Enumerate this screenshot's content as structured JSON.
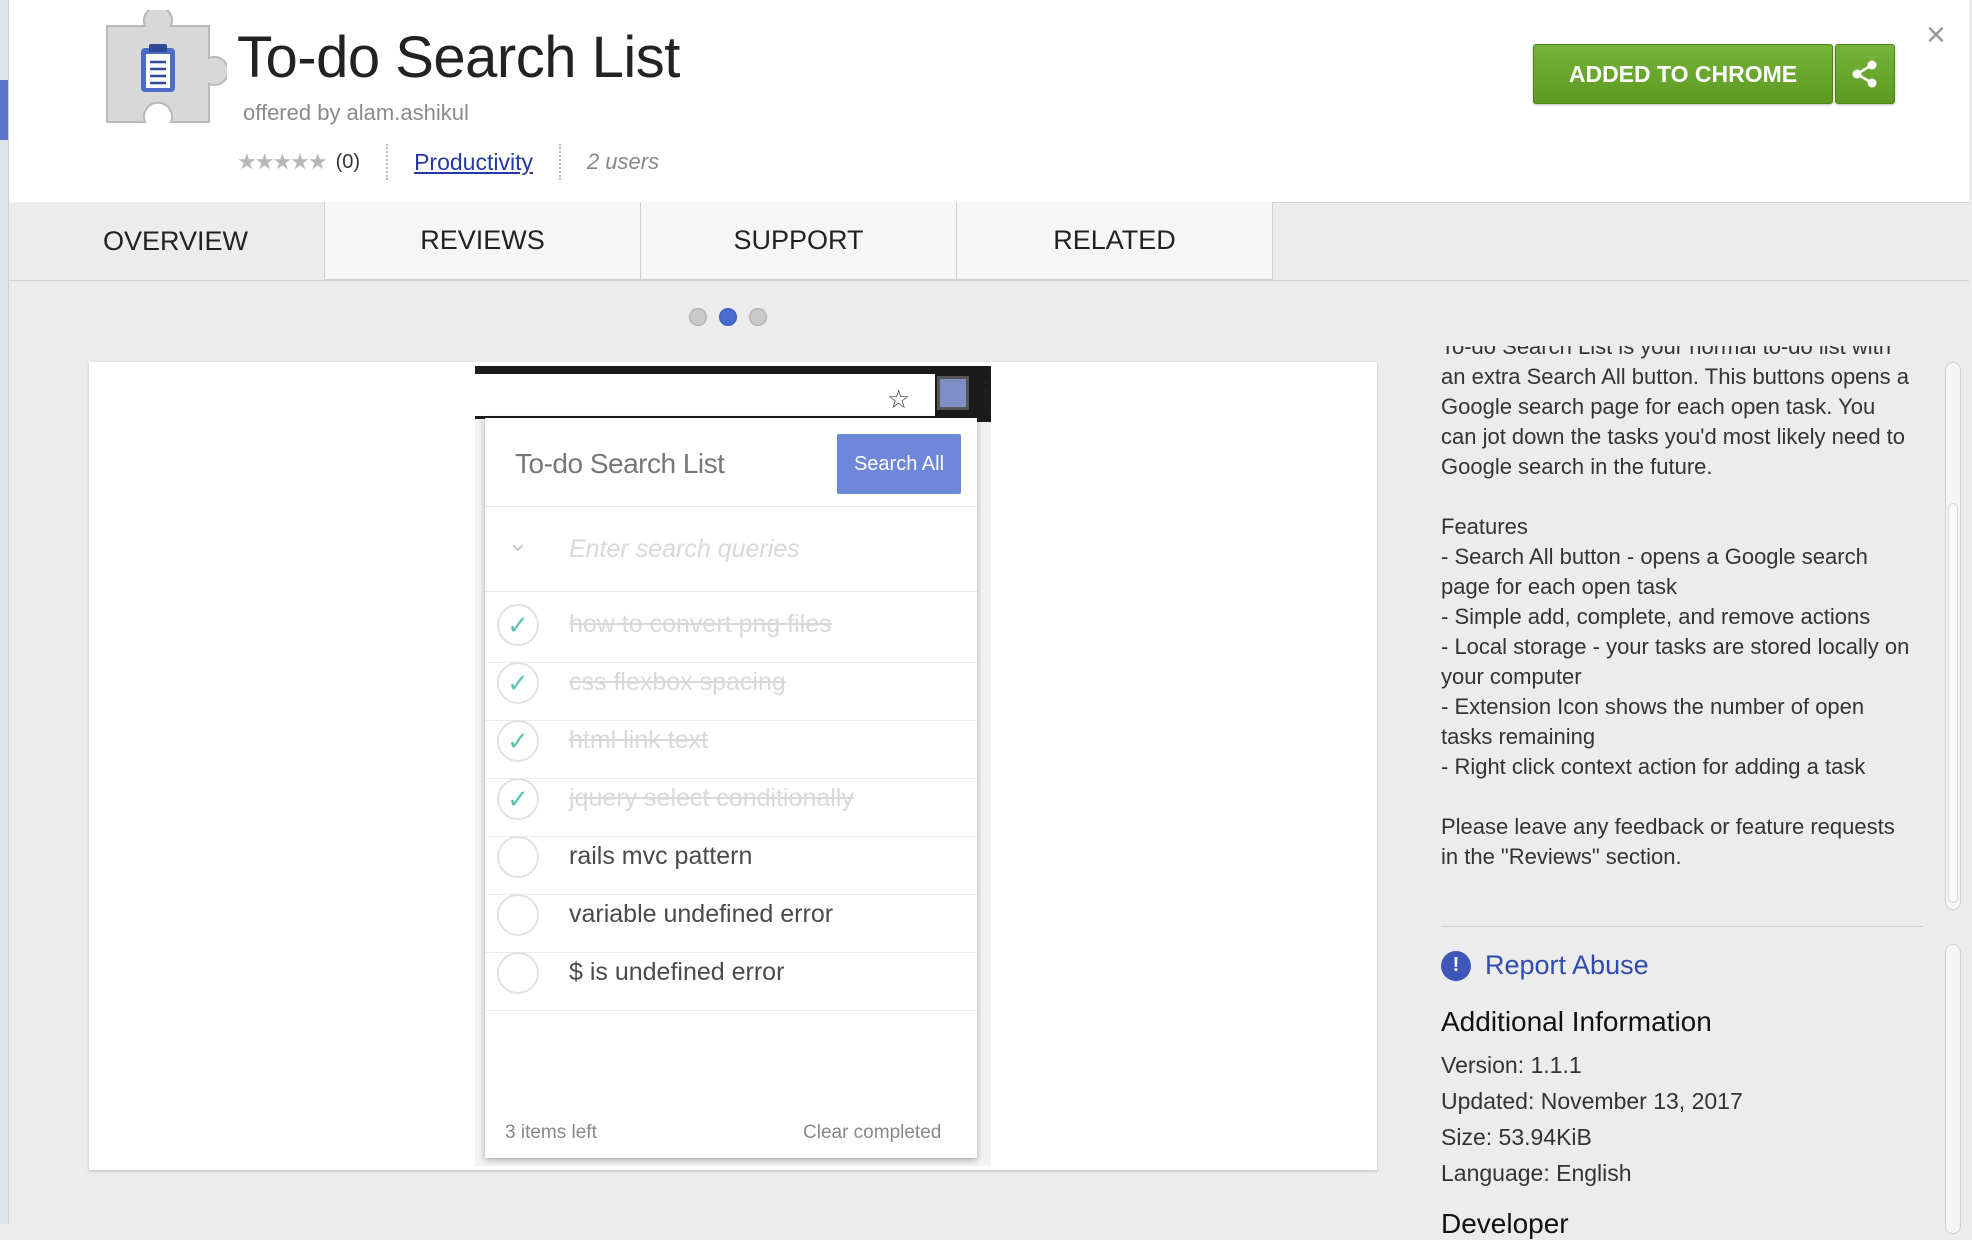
{
  "window": {
    "close_glyph": "×"
  },
  "header": {
    "title": "To-do Search List",
    "offered_by": "offered by alam.ashikul",
    "rating_stars": "★★★★★",
    "rating_count": "(0)",
    "category": "Productivity",
    "users": "2 users",
    "added_button": "ADDED TO CHROME",
    "share_icon": "share-icon",
    "icon": "puzzle-clipboard-icon"
  },
  "tabs": [
    {
      "label": "OVERVIEW",
      "active": true
    },
    {
      "label": "REVIEWS",
      "active": false
    },
    {
      "label": "SUPPORT",
      "active": false
    },
    {
      "label": "RELATED",
      "active": false
    }
  ],
  "carousel": {
    "count": 3,
    "active_index": 1
  },
  "screenshot": {
    "star_glyph": "☆",
    "more_glyph": "⋮",
    "popup_title": "To-do Search List",
    "search_all": "Search All",
    "chevron": "⌄",
    "placeholder": "Enter search queries",
    "check_glyph": "✓",
    "items": [
      {
        "text": "how to convert png files",
        "done": true
      },
      {
        "text": "css flexbox spacing",
        "done": true
      },
      {
        "text": "html link text",
        "done": true
      },
      {
        "text": "jquery select conditionally",
        "done": true
      },
      {
        "text": "rails mvc pattern",
        "done": false
      },
      {
        "text": "variable undefined error",
        "done": false
      },
      {
        "text": "$ is undefined error",
        "done": false
      }
    ],
    "items_left": "3 items left",
    "clear_completed": "Clear completed"
  },
  "description": {
    "intro": "To-do Search List is your normal to-do list with an extra Search All button. This buttons opens a Google search page for each open task. You can jot down the tasks you'd most likely need to Google search in the future.",
    "features_heading": "Features",
    "features": [
      "- Search All button - opens a Google search page for each open task",
      "- Simple add, complete, and remove actions",
      "- Local storage - your tasks are stored locally on your computer",
      "- Extension Icon shows the number of open tasks remaining",
      "- Right click context action for adding a task"
    ],
    "outro": "Please leave any feedback or feature requests in the \"Reviews\" section."
  },
  "report": {
    "icon_glyph": "!",
    "label": "Report Abuse"
  },
  "additional": {
    "heading": "Additional Information",
    "version": "Version: 1.1.1",
    "updated": "Updated: November 13, 2017",
    "size": "Size: 53.94KiB",
    "language": "Language: English",
    "next_heading": "Developer"
  },
  "colors": {
    "accent_green": "#6aa72f",
    "link_blue": "#2538a8",
    "popup_button": "#6f87db",
    "check_teal": "#5dc2af"
  }
}
